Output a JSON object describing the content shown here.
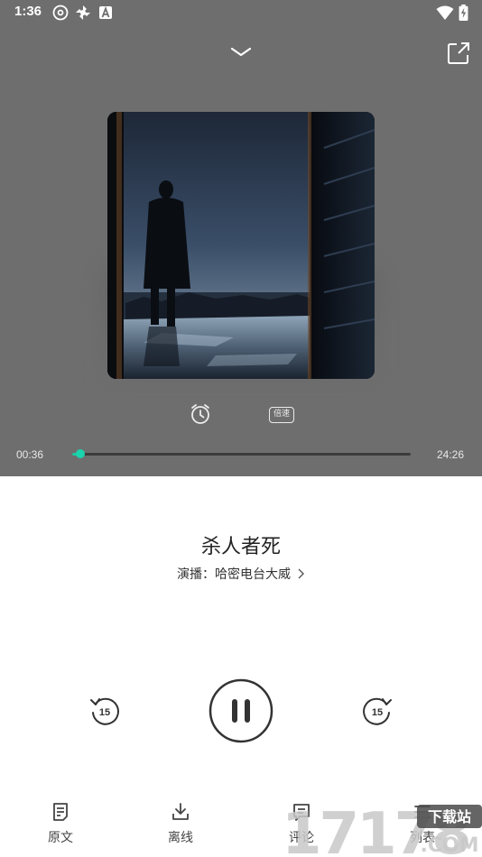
{
  "status_bar": {
    "time": "1:36",
    "left_icons": [
      "disc-icon",
      "pinwheel-icon",
      "text-a-icon"
    ],
    "right_icons": [
      "wifi-icon",
      "battery-charging-icon"
    ]
  },
  "header": {
    "collapse_icon": "chevron-down-icon",
    "share_icon": "share-external-icon"
  },
  "player": {
    "cover_art_icon": "album-cover",
    "tools": {
      "timer_icon": "alarm-clock-icon",
      "speed_label": "倍速"
    },
    "elapsed": "00:36",
    "duration": "24:26",
    "progress_fraction": 0.0245,
    "accent_color": "#1bc8a2",
    "title": "杀人者死",
    "artist_line": "演播：哈密电台大威",
    "rewind_label": "15",
    "forward_label": "15",
    "state": "playing"
  },
  "bottom_nav": [
    {
      "label": "原文",
      "icon": "document-icon"
    },
    {
      "label": "离线",
      "icon": "download-icon"
    },
    {
      "label": "评论",
      "icon": "comment-icon"
    },
    {
      "label": "列表",
      "icon": "list-icon"
    }
  ],
  "watermark": {
    "text": "17178",
    "sub1": "下载站",
    "sub2": ".COM"
  }
}
